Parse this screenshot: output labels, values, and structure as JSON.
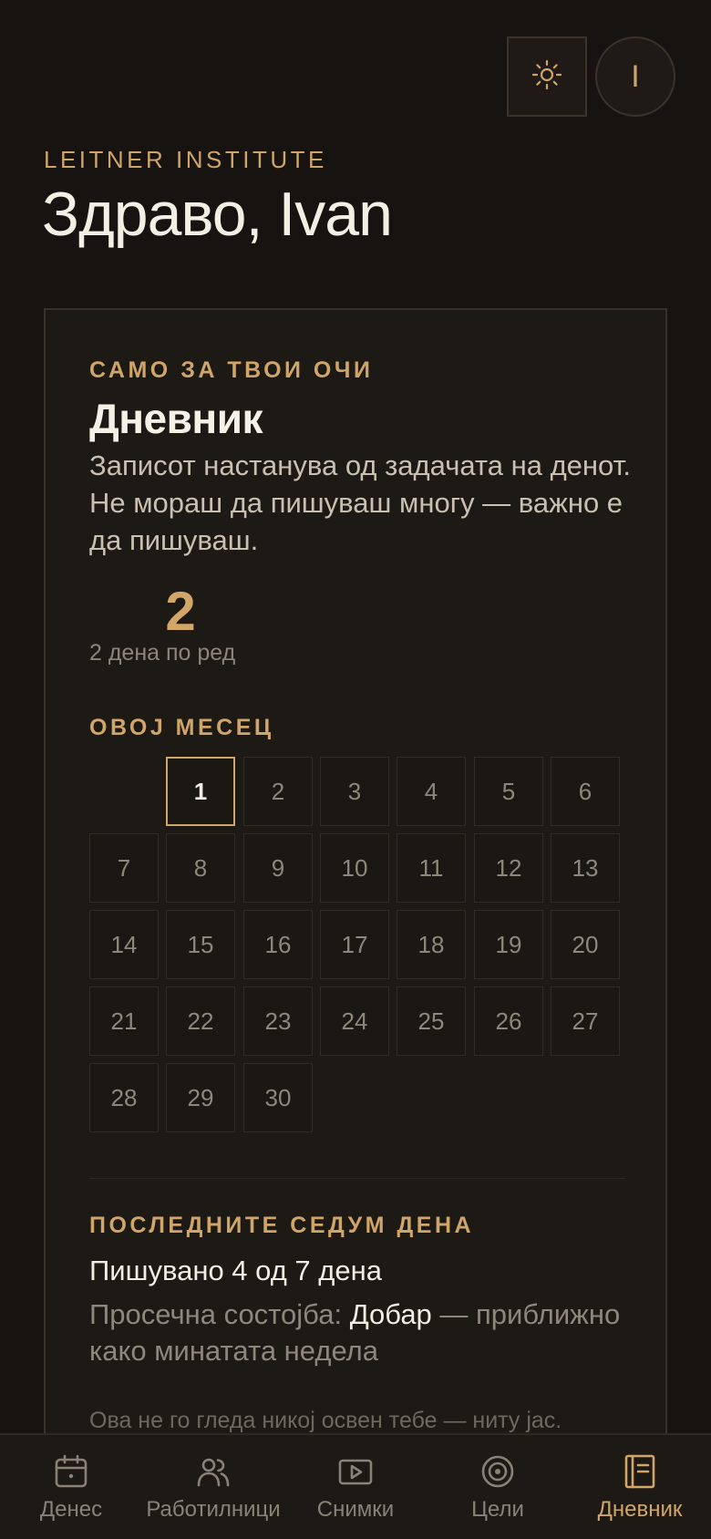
{
  "header": {
    "theme_icon": "sun-icon",
    "avatar_initial": "I",
    "brand": "LEITNER INSTITUTE",
    "greeting": "Здраво, Ivan"
  },
  "journal": {
    "eyebrow": "САМО ЗА ТВОИ ОЧИ",
    "title": "Дневник",
    "description": "Записот настанува од задачата на денот. Не мораш да пишуваш многу — важно е да пишуваш.",
    "streak_count": "2",
    "streak_label": "2 дена по ред",
    "month_eyebrow": "ОВОЈ МЕСЕЦ",
    "days": [
      "1",
      "2",
      "3",
      "4",
      "5",
      "6",
      "7",
      "8",
      "9",
      "10",
      "11",
      "12",
      "13",
      "14",
      "15",
      "16",
      "17",
      "18",
      "19",
      "20",
      "21",
      "22",
      "23",
      "24",
      "25",
      "26",
      "27",
      "28",
      "29",
      "30"
    ],
    "today": "1",
    "week_eyebrow": "ПОСЛЕДНИТЕ СЕДУМ ДЕНА",
    "written_summary": "Пишувано 4 од 7 дена",
    "mood_prefix": "Просечна состојба: ",
    "mood_value": "Добар",
    "mood_suffix": " — приближно како минатата недела",
    "private_note": "Ова не го гледа никој освен тебе — ниту јас."
  },
  "nav": {
    "items": [
      {
        "label": "Денес",
        "icon": "calendar-icon"
      },
      {
        "label": "Работилници",
        "icon": "users-icon"
      },
      {
        "label": "Снимки",
        "icon": "video-icon"
      },
      {
        "label": "Цели",
        "icon": "target-icon"
      },
      {
        "label": "Дневник",
        "icon": "journal-icon"
      }
    ],
    "active_index": 4
  },
  "colors": {
    "background": "#161310",
    "card": "#1d1915",
    "accent": "#cfa56a",
    "text": "#f2ece1",
    "muted": "#8e877b"
  }
}
